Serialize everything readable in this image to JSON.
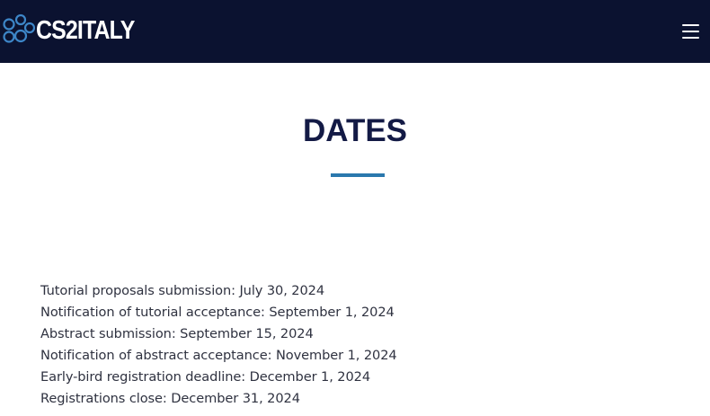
{
  "header": {
    "logo_text": "CS2ITALY",
    "menu_icon": "hamburger-menu-icon"
  },
  "main": {
    "title": "DATES",
    "dates": [
      "Tutorial proposals submission: July 30, 2024",
      "Notification of tutorial acceptance: September 1, 2024",
      "Abstract submission: September 15, 2024",
      "Notification of abstract acceptance: November 1, 2024",
      "Early-bird registration deadline: December 1, 2024",
      "Registrations close: December 31, 2024"
    ]
  },
  "colors": {
    "navbar_bg": "#0b1230",
    "title": "#131a45",
    "accent": "#2a78ad",
    "logo_circles": "#3d86c8",
    "body_text": "#2f3240"
  }
}
